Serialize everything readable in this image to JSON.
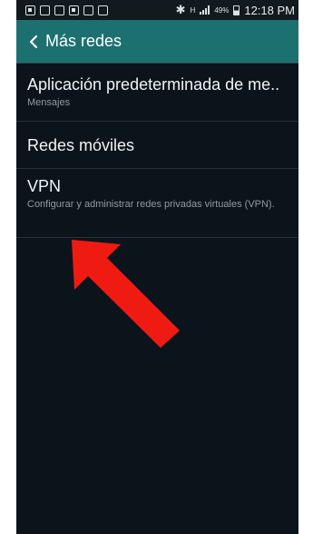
{
  "status_bar": {
    "signal_label": "H",
    "battery_percent": "49%",
    "time": "12:18 PM"
  },
  "action_bar": {
    "title": "Más redes"
  },
  "settings": [
    {
      "title": "Aplicación predeterminada de me..",
      "subtitle": "Mensajes"
    },
    {
      "title": "Redes móviles",
      "subtitle": ""
    },
    {
      "title": "VPN",
      "subtitle": "Configurar y administrar redes privadas virtuales (VPN)."
    }
  ],
  "colors": {
    "action_bar": "#1d7070",
    "background": "#0c141b",
    "annotation_arrow": "#ef1b12"
  }
}
